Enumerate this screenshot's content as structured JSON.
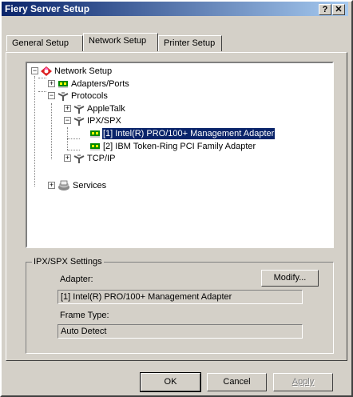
{
  "window": {
    "title": "Fiery Server Setup",
    "help_label": "?",
    "close_label": "✕"
  },
  "tabs": [
    {
      "label": "General Setup"
    },
    {
      "label": "Network Setup"
    },
    {
      "label": "Printer Setup"
    }
  ],
  "tree": {
    "root": {
      "label": "Network Setup",
      "expander": "−",
      "icon": "network-setup-icon"
    },
    "adapters": {
      "label": "Adapters/Ports",
      "expander": "+",
      "icon": "network-card-icon"
    },
    "protocols": {
      "label": "Protocols",
      "expander": "−",
      "icon": "protocol-icon"
    },
    "appletalk": {
      "label": "AppleTalk",
      "expander": "+",
      "icon": "protocol-icon"
    },
    "ipxspx": {
      "label": "IPX/SPX",
      "expander": "−",
      "icon": "protocol-icon"
    },
    "ipx_adapter_1": {
      "label": "[1] Intel(R) PRO/100+ Management Adapter",
      "icon": "network-card-icon",
      "selected": true
    },
    "ipx_adapter_2": {
      "label": "[2] IBM Token-Ring PCI Family Adapter",
      "icon": "network-card-icon"
    },
    "tcpip": {
      "label": "TCP/IP",
      "expander": "+",
      "icon": "protocol-icon"
    },
    "services": {
      "label": "Services",
      "expander": "+",
      "icon": "services-icon"
    }
  },
  "settings": {
    "legend": "IPX/SPX Settings",
    "adapter_label": "Adapter:",
    "modify_label": "Modify...",
    "adapter_value": "[1] Intel(R) PRO/100+ Management Adapter",
    "frame_type_label": "Frame Type:",
    "frame_type_value": "Auto Detect"
  },
  "buttons": {
    "ok": "OK",
    "cancel": "Cancel",
    "apply": "Apply"
  },
  "colors": {
    "title_start": "#0a246a",
    "title_end": "#a6caf0",
    "selection": "#0a246a",
    "face": "#d4d0c8"
  }
}
